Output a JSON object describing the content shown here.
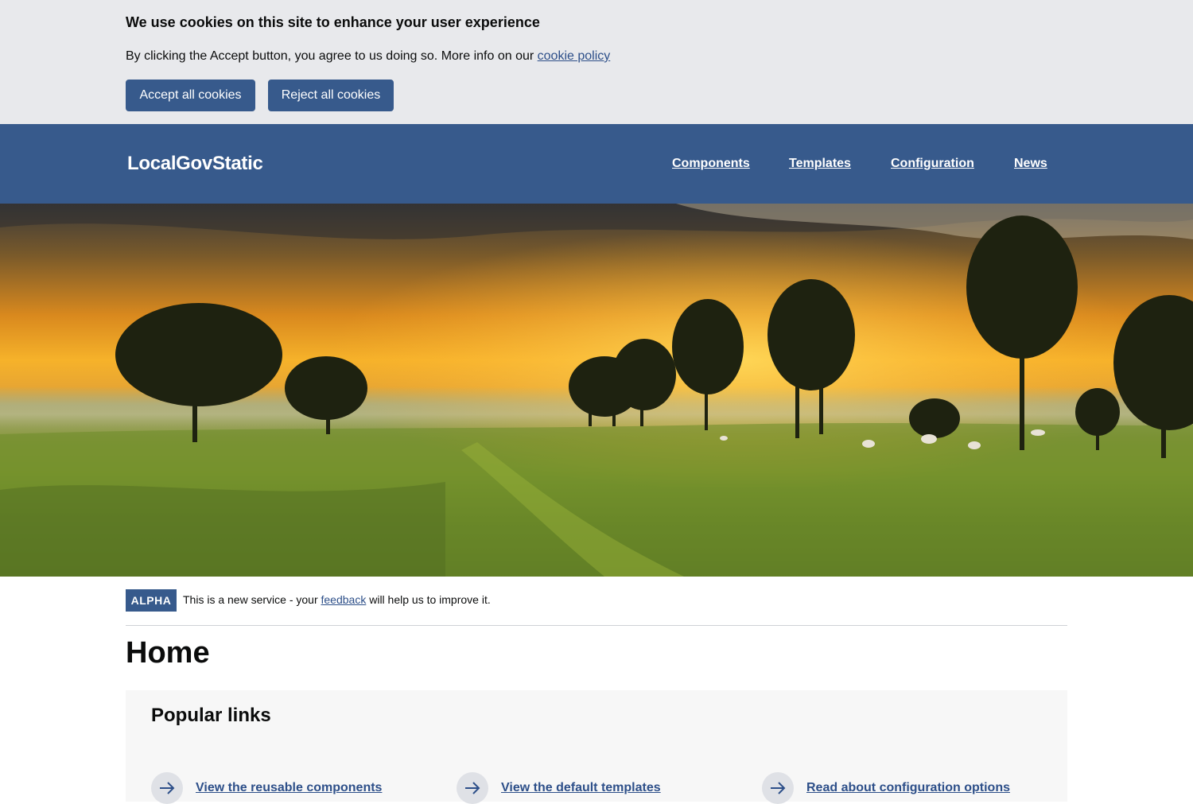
{
  "cookie_banner": {
    "heading": "We use cookies on this site to enhance your user experience",
    "text_before": "By clicking the Accept button, you agree to us doing so. More info on our ",
    "policy_link": "cookie policy",
    "accept_label": "Accept all cookies",
    "reject_label": "Reject all cookies"
  },
  "header": {
    "logo": "LocalGovStatic",
    "nav": [
      "Components",
      "Templates",
      "Configuration",
      "News"
    ]
  },
  "hero": {
    "icon": "landscape-sunset-image"
  },
  "phase_banner": {
    "tag": "ALPHA",
    "text_before": "This is a new service - your ",
    "link": "feedback",
    "text_after": " will help us to improve it."
  },
  "page": {
    "title": "Home"
  },
  "popular_links": {
    "title": "Popular links",
    "items": [
      {
        "label": "View the reusable components",
        "icon": "arrow-right-icon"
      },
      {
        "label": "View the default templates",
        "icon": "arrow-right-icon"
      },
      {
        "label": "Read about configuration options",
        "icon": "arrow-right-icon"
      }
    ]
  },
  "colors": {
    "brand": "#375a8c",
    "link": "#2d4f89",
    "cookie_bg": "#e8e9ec"
  }
}
